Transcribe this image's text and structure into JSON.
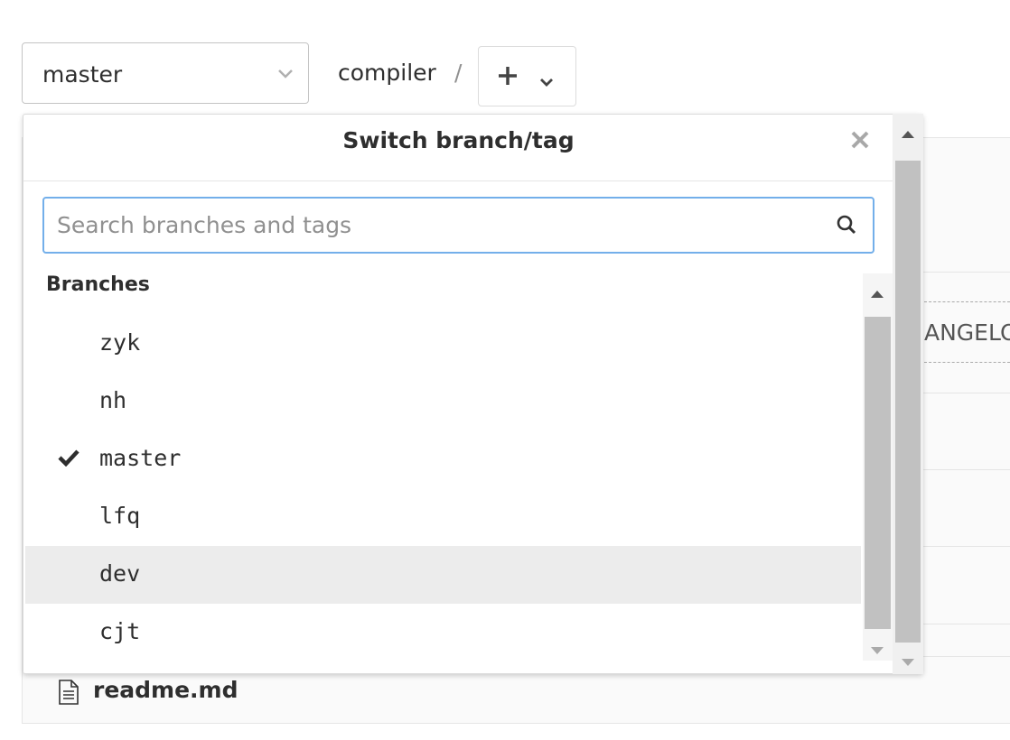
{
  "toolbar": {
    "branch_value": "master",
    "project": "compiler",
    "separator": "/"
  },
  "background": {
    "changelog_partial": "ANGELO",
    "readme_name": "readme.md"
  },
  "dropdown": {
    "title": "Switch branch/tag",
    "search_placeholder": "Search branches and tags",
    "search_value": "",
    "section_header": "Branches",
    "branches": [
      {
        "name": "zyk",
        "selected": false,
        "hovered": false
      },
      {
        "name": "nh",
        "selected": false,
        "hovered": false
      },
      {
        "name": "master",
        "selected": true,
        "hovered": false
      },
      {
        "name": "lfq",
        "selected": false,
        "hovered": false
      },
      {
        "name": "dev",
        "selected": false,
        "hovered": true
      },
      {
        "name": "cjt",
        "selected": false,
        "hovered": false
      }
    ]
  },
  "colors": {
    "search_focus_border": "#73afea",
    "hover_row": "#ececec",
    "text": "#2e2e2e",
    "placeholder": "#909090"
  },
  "icons": {
    "select_chevron": "chevron-down-icon",
    "add": "plus-icon",
    "close": "close-icon",
    "search": "search-icon",
    "selected": "check-icon",
    "file": "document-icon"
  }
}
